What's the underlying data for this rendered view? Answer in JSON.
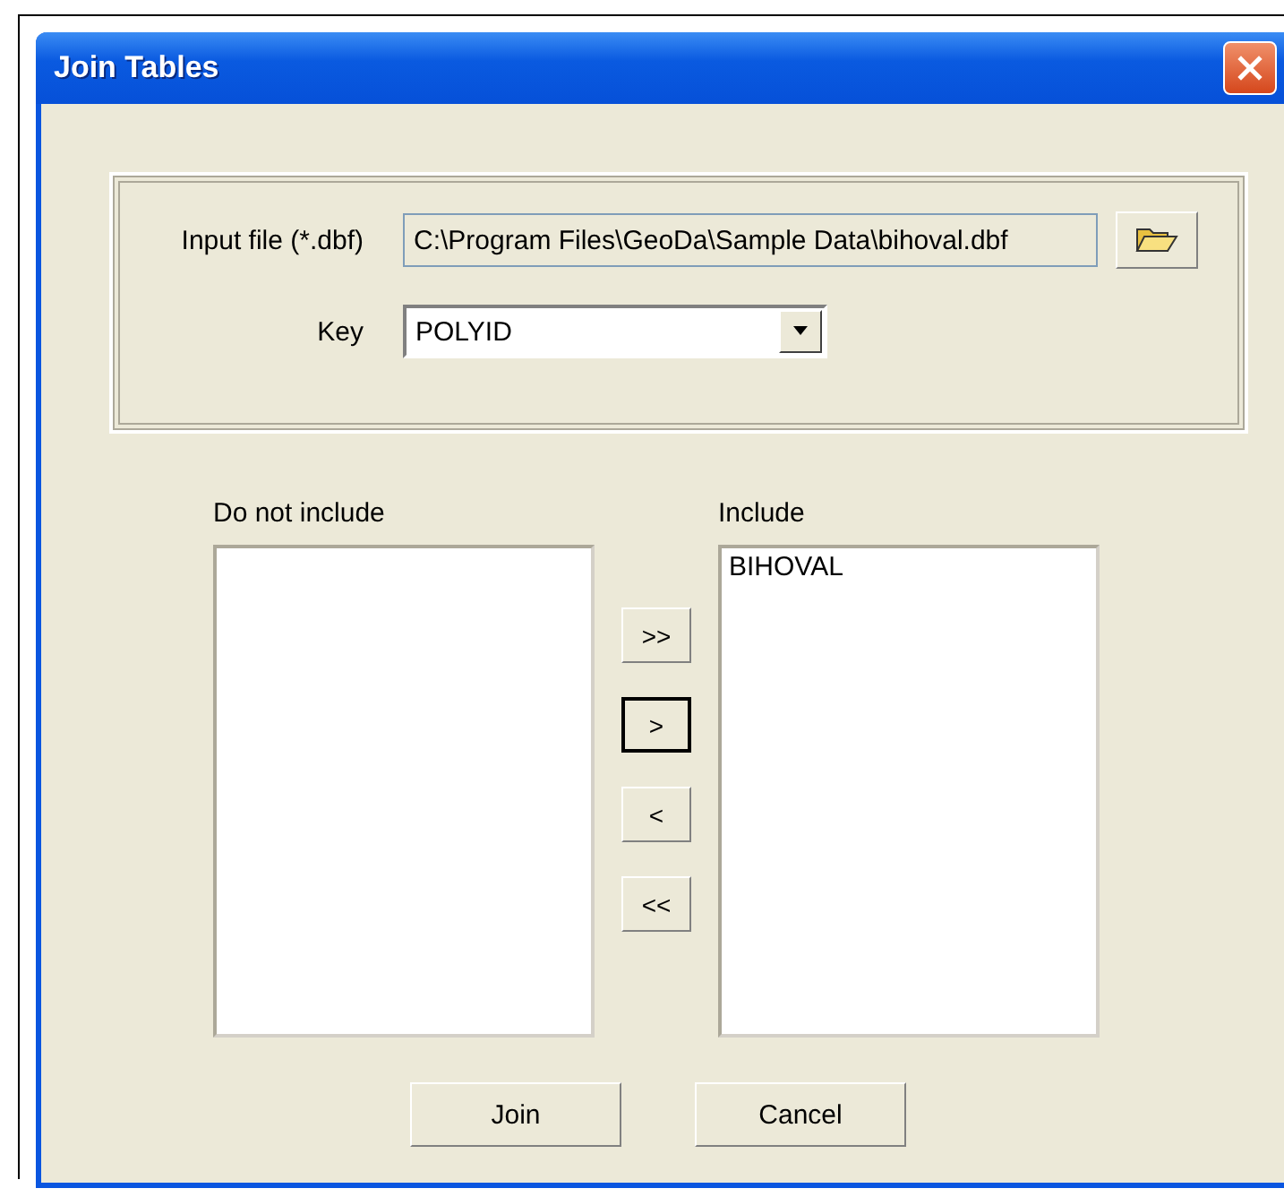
{
  "window": {
    "title": "Join Tables"
  },
  "input_file": {
    "label": "Input file (*.dbf)",
    "value": "C:\\Program Files\\GeoDa\\Sample Data\\bihoval.dbf"
  },
  "key": {
    "label": "Key",
    "value": "POLYID"
  },
  "do_not_include": {
    "label": "Do not include"
  },
  "include": {
    "label": "Include",
    "items": [
      "BIHOVAL"
    ]
  },
  "move_buttons": [
    {
      "label": ">>",
      "focused": false
    },
    {
      "label": ">",
      "focused": true
    },
    {
      "label": "<",
      "focused": false
    },
    {
      "label": "<<",
      "focused": false
    }
  ],
  "buttons": [
    "Join",
    "Cancel"
  ]
}
